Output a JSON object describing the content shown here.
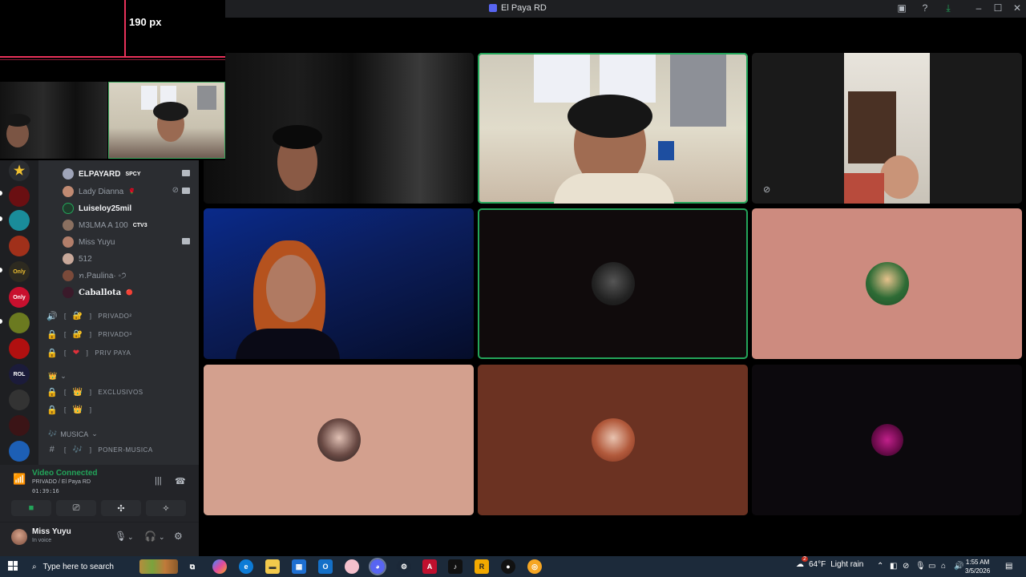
{
  "window": {
    "title": "El Paya RD"
  },
  "overlay": {
    "measure_label": "190 px"
  },
  "voice_members": [
    {
      "name": "ELPAYARD",
      "tag": "SPCY",
      "bold": true,
      "camera": true
    },
    {
      "name": "Lady Dianna",
      "tag": "🌹",
      "bold": false,
      "camera": true,
      "muted": true
    },
    {
      "name": "Luiseloy25mil",
      "tag": "",
      "bold": true,
      "camera": false
    },
    {
      "name": "M3LMA A 100",
      "tag": "CTV3",
      "bold": false,
      "camera": false
    },
    {
      "name": "Miss Yuyu",
      "tag": "",
      "bold": false,
      "camera": true
    },
    {
      "name": "512",
      "tag": "",
      "bold": false,
      "camera": false
    },
    {
      "name": "ꪀ.Paulina· ◦੭",
      "tag": "",
      "bold": false,
      "camera": false
    },
    {
      "name": "Caballota",
      "tag": "🔴",
      "bold": true,
      "camera": false
    }
  ],
  "channels": [
    {
      "icon": "🔊",
      "label": "PRIVADO²",
      "emoji": "🔐"
    },
    {
      "icon": "🔒",
      "label": "PRIVADO³",
      "emoji": "🔐"
    },
    {
      "icon": "🔒",
      "label": "PRIV PAYA",
      "emoji": "❤"
    }
  ],
  "categories": [
    {
      "label": "👑",
      "channels": [
        {
          "icon": "🔒",
          "label": "EXCLUSIVOS",
          "emoji": "👑"
        },
        {
          "icon": "🔒",
          "label": "",
          "emoji": "👑"
        }
      ]
    },
    {
      "label": "MUSICA",
      "channels": [
        {
          "icon": "#",
          "label": "PONER-MUSICA",
          "emoji": "🎶"
        }
      ]
    }
  ],
  "voice_panel": {
    "status": "Video Connected",
    "location": "PRIVADO / El Paya RD",
    "timer": "01:39:16"
  },
  "user": {
    "name": "Miss Yuyu",
    "status": "In voice"
  },
  "taskbar": {
    "search_placeholder": "Type here to search",
    "weather_temp": "64°F",
    "weather_text": "Light rain",
    "weather_badge": "2",
    "time": "1:55 AM",
    "date": "3/5/2026"
  },
  "colors": {
    "speaking_outline": "#23a55a",
    "tile_pink": "#cd8b7f",
    "tile_peach": "#d3a08e",
    "tile_brown": "#6b3222",
    "discord_blurple": "#5865f2"
  }
}
